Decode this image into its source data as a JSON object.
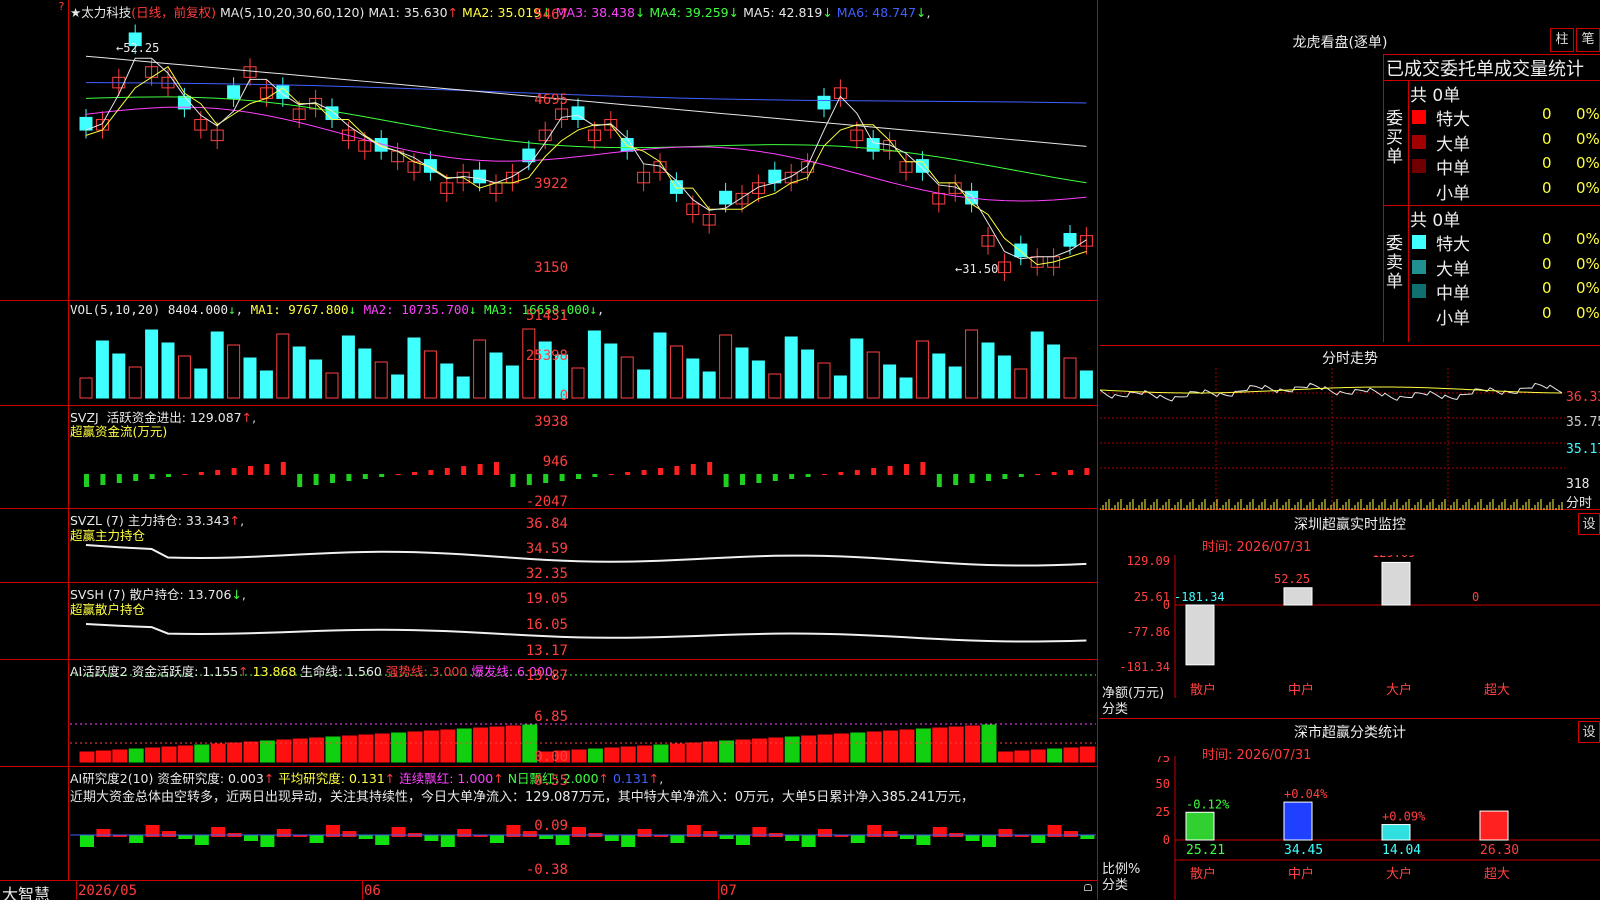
{
  "main": {
    "stock_name": "★太力科技",
    "period_label": "(日线，前复权)",
    "ma_params": "MA(5,10,20,30,60,120)",
    "ma": [
      {
        "label": "MA1:",
        "value": "35.630",
        "arrow": "↑",
        "color": "#e8e8e8"
      },
      {
        "label": "MA2:",
        "value": "35.019",
        "arrow": "↓",
        "color": "#ffff40"
      },
      {
        "label": "MA3:",
        "value": "38.438",
        "arrow": "↓",
        "color": "#ff40ff"
      },
      {
        "label": "MA4:",
        "value": "39.259",
        "arrow": "↓",
        "color": "#40ff40"
      },
      {
        "label": "MA5:",
        "value": "42.819",
        "arrow": "↓",
        "color": "#e8e8e8"
      },
      {
        "label": "MA6:",
        "value": "48.747",
        "arrow": "↓",
        "color": "#4060ff"
      }
    ],
    "y_ticks": [
      "5467",
      "4695",
      "3922",
      "3150"
    ],
    "high_marker": "52.25",
    "low_marker": "31.50"
  },
  "volume": {
    "title": "VOL(5,10,20)",
    "value": "8404.000",
    "value_arrow": "↓",
    "ma": [
      {
        "label": "MA1:",
        "value": "9767.800",
        "arrow": "↓",
        "color": "#ffff40"
      },
      {
        "label": "MA2:",
        "value": "10735.700",
        "arrow": "↓",
        "color": "#ff40ff"
      },
      {
        "label": "MA3:",
        "value": "16658.000",
        "arrow": "↓",
        "color": "#40ff40"
      }
    ],
    "y_ticks": [
      "51431",
      "25398",
      "0"
    ]
  },
  "svzj": {
    "title": "SVZJ",
    "label": "活跃资金进出:",
    "value": "129.087",
    "arrow": "↑",
    "subtitle": "超赢资金流(万元)",
    "y_ticks": [
      "3938",
      "946",
      "-2047"
    ]
  },
  "svzl": {
    "title": "SVZL (7)",
    "label": "主力持仓:",
    "value": "33.343",
    "arrow": "↑",
    "subtitle": "超赢主力持仓",
    "y_ticks": [
      "36.84",
      "34.59",
      "32.35"
    ]
  },
  "svsh": {
    "title": "SVSH (7)",
    "label": "散户持仓:",
    "value": "13.706",
    "arrow": "↓",
    "subtitle": "超赢散户持仓",
    "y_ticks": [
      "19.05",
      "16.05",
      "13.17"
    ]
  },
  "ai_active": {
    "title": "AI活跃度2",
    "items": [
      {
        "text": "资金活跃度: 1.155",
        "arrow": "↑",
        "color": "#e8e8e8"
      },
      {
        "text": "13.868",
        "arrow": "",
        "color": "#ffff40"
      },
      {
        "text": "生命线: 1.560",
        "arrow": "",
        "color": "#e8e8e8"
      },
      {
        "text": "强势线: 3.000",
        "arrow": "",
        "color": "#ff3c3c"
      },
      {
        "text": "爆发线: 6.000",
        "arrow": "",
        "color": "#ff40ff"
      }
    ],
    "y_ticks": [
      "13.87",
      "6.85",
      "0.00"
    ]
  },
  "ai_research": {
    "title": "AI研究度2(10)",
    "items": [
      {
        "text": "资金研究度: 0.003",
        "arrow": "↑",
        "color": "#e8e8e8"
      },
      {
        "text": "平均研究度: 0.131",
        "arrow": "↑",
        "color": "#ffff40"
      },
      {
        "text": "连续飘红: 1.000",
        "arrow": "↑",
        "color": "#ff40ff"
      },
      {
        "text": "N日飘红: 2.000",
        "arrow": "↑",
        "color": "#40ff40"
      },
      {
        "text": "0.131",
        "arrow": "↑",
        "color": "#4060ff"
      }
    ],
    "commentary": "近期大资金总体由空转多，近两日出现异动，关注其持续性，今日大单净流入：129.087万元，其中特大单净流入：0万元，大单5日累计净入385.241万元，",
    "y_ticks": [
      "0.55",
      "0.09",
      "-0.38"
    ]
  },
  "bottom_bar": {
    "brand": "大智慧",
    "date_start": "2026/05",
    "month_6": "06",
    "month_7": "07"
  },
  "dragon_tiger": {
    "title": "龙虎看盘(逐单)",
    "btn_bar": "柱",
    "btn_pen": "笔",
    "header": "已成交委托单成交量统计",
    "buy_label": "委买单",
    "sell_label": "委卖单",
    "buy_total": "共 0单",
    "sell_total": "共 0单",
    "buy_rows": [
      {
        "name": "特大",
        "count": "0",
        "pct": "0%",
        "color": "#ff0000"
      },
      {
        "name": "大单",
        "count": "0",
        "pct": "0%",
        "color": "#a00000"
      },
      {
        "name": "中单",
        "count": "0",
        "pct": "0%",
        "color": "#700000"
      },
      {
        "name": "小单",
        "count": "0",
        "pct": "0%",
        "color": ""
      }
    ],
    "sell_rows": [
      {
        "name": "特大",
        "count": "0",
        "pct": "0%",
        "color": "#40ffff"
      },
      {
        "name": "大单",
        "count": "0",
        "pct": "0%",
        "color": "#209090"
      },
      {
        "name": "中单",
        "count": "0",
        "pct": "0%",
        "color": "#107070"
      },
      {
        "name": "小单",
        "count": "0",
        "pct": "0%",
        "color": ""
      }
    ]
  },
  "intraday": {
    "title": "分时走势",
    "y_labels": [
      "36.33",
      "35.75",
      "35.17"
    ],
    "vol_label": "318",
    "vol_unit": "分时"
  },
  "sz_monitor": {
    "title": "深圳超赢实时监控",
    "set_btn": "设",
    "time_label": "时间: 2026/07/31",
    "y_ticks": [
      "129.09",
      "25.61",
      "0",
      "-77.86",
      "-181.34"
    ],
    "unit_label": "净额(万元)",
    "cat_label": "分类",
    "categories": [
      "散户",
      "中户",
      "大户",
      "超大"
    ],
    "values": [
      -181.34,
      52.25,
      129.09,
      0
    ],
    "value_labels": [
      "-181.34",
      "52.25",
      "129.09",
      "0"
    ]
  },
  "sz_class": {
    "title": "深市超赢分类统计",
    "set_btn": "设",
    "time_label": "时间: 2026/07/31",
    "y_ticks": [
      "75",
      "50",
      "25",
      "0"
    ],
    "ratio_label": "比例%",
    "cat_label": "分类",
    "categories": [
      "散户",
      "中户",
      "大户",
      "超大"
    ],
    "values": [
      25.21,
      34.45,
      14.04,
      26.3
    ],
    "value_labels": [
      "25.21",
      "34.45",
      "14.04",
      "26.30"
    ],
    "changes": [
      "-0.12%",
      "+0.04%",
      "+0.09%",
      ""
    ]
  }
}
